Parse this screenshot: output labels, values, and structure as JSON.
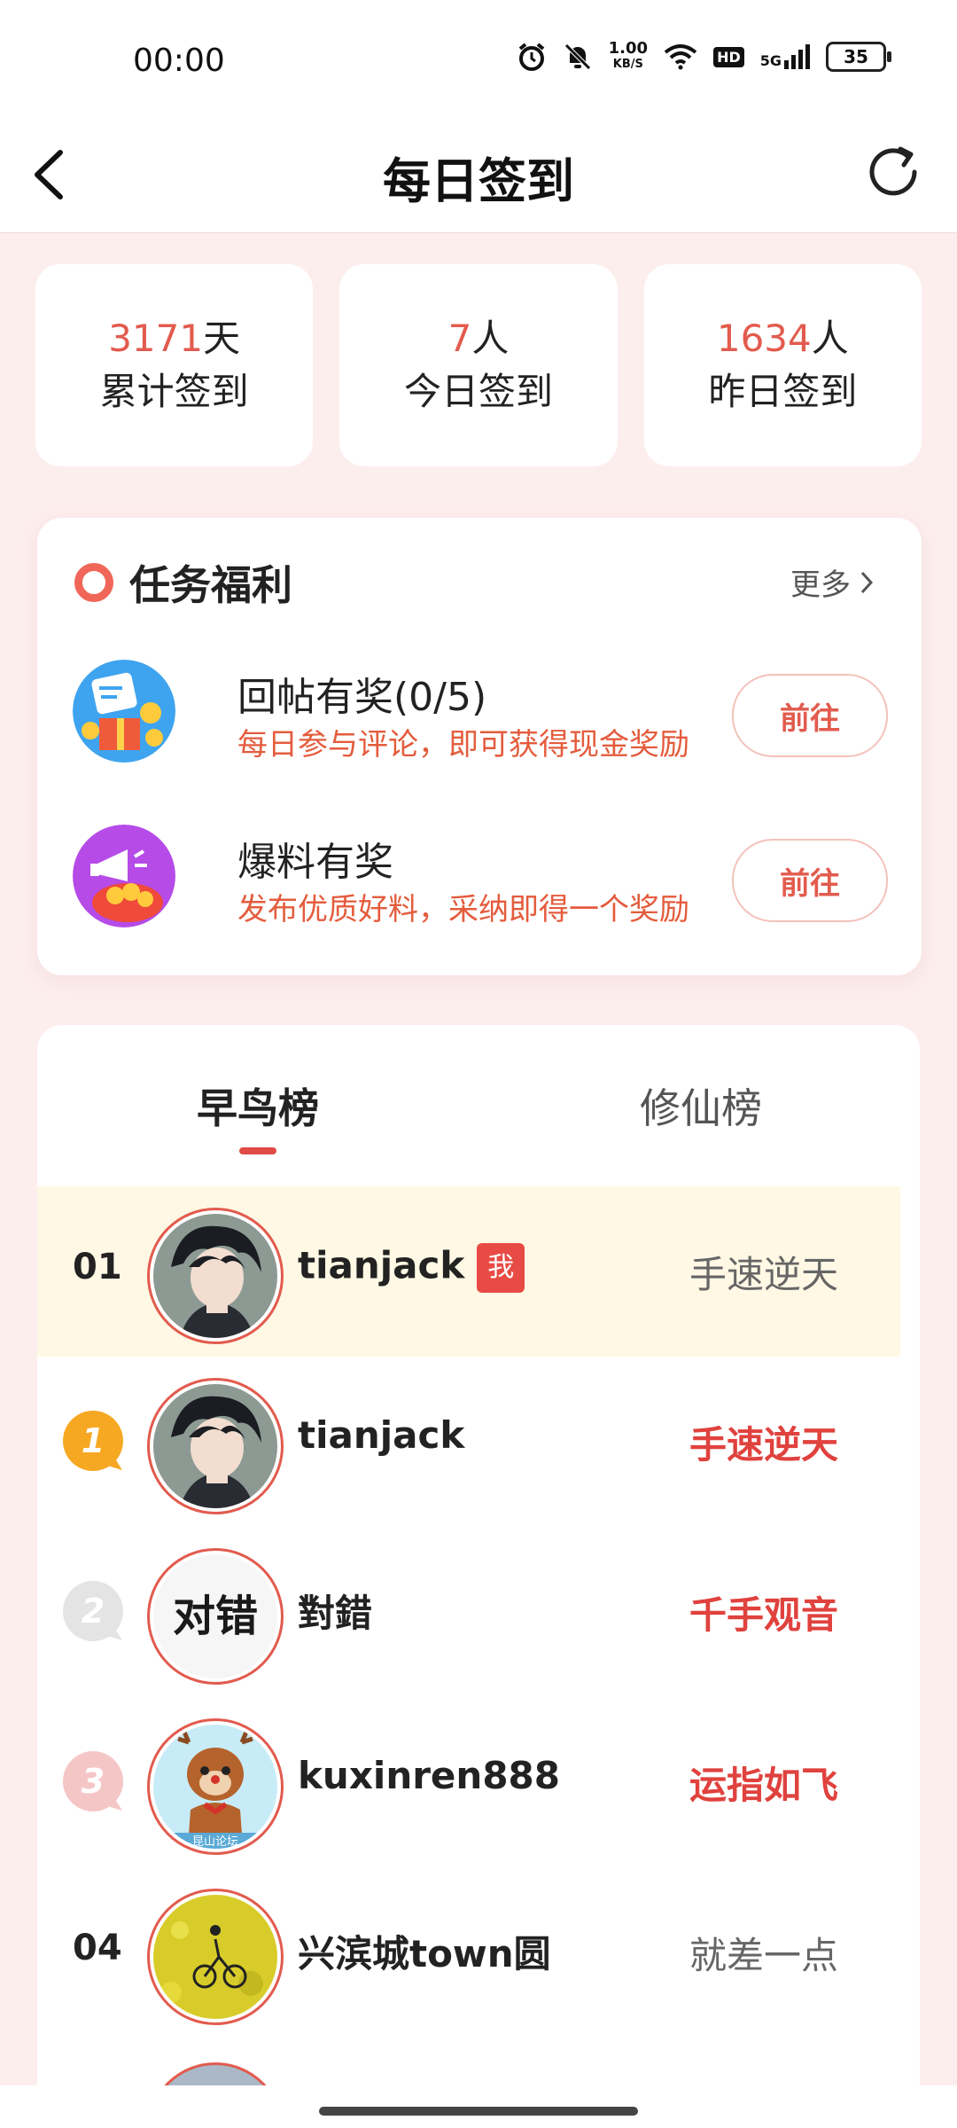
{
  "status_bar": {
    "time": "00:00",
    "net_speed_value": "1.00",
    "net_speed_unit": "KB/S",
    "hd": "HD",
    "network": "5G",
    "battery": "35"
  },
  "header": {
    "title": "每日签到",
    "back_icon": "chevron-left-icon",
    "refresh_icon": "refresh-icon"
  },
  "stats": [
    {
      "number": "3171",
      "unit": "天",
      "label": "累计签到"
    },
    {
      "number": "7",
      "unit": "人",
      "label": "今日签到"
    },
    {
      "number": "1634",
      "unit": "人",
      "label": "昨日签到"
    }
  ],
  "tasks": {
    "title": "任务福利",
    "more": "更多",
    "items": [
      {
        "name": "回帖有奖(0/5)",
        "desc": "每日参与评论，即可获得现金奖励",
        "button": "前往"
      },
      {
        "name": "爆料有奖",
        "desc": "发布优质好料，采纳即得一个奖励",
        "button": "前往"
      }
    ]
  },
  "board": {
    "tabs": [
      "早鸟榜",
      "修仙榜"
    ],
    "me_badge": "我",
    "rows": [
      {
        "rank": "01",
        "name": "tianjack",
        "title": "手速逆天"
      },
      {
        "rank": "1",
        "name": "tianjack",
        "title": "手速逆天"
      },
      {
        "rank": "2",
        "name": "對錯",
        "title": "千手观音"
      },
      {
        "rank": "3",
        "name": "kuxinren888",
        "title": "运指如飞"
      },
      {
        "rank": "04",
        "name": "兴滨城town圆",
        "title": "就差一点"
      }
    ],
    "avatar_texts": {
      "cuo": "对错",
      "deer_caption": "昆山论坛"
    }
  },
  "colors": {
    "accent": "#e25b4e",
    "page_bg": "#fdeeee",
    "highlight_row": "#fef8e4"
  }
}
